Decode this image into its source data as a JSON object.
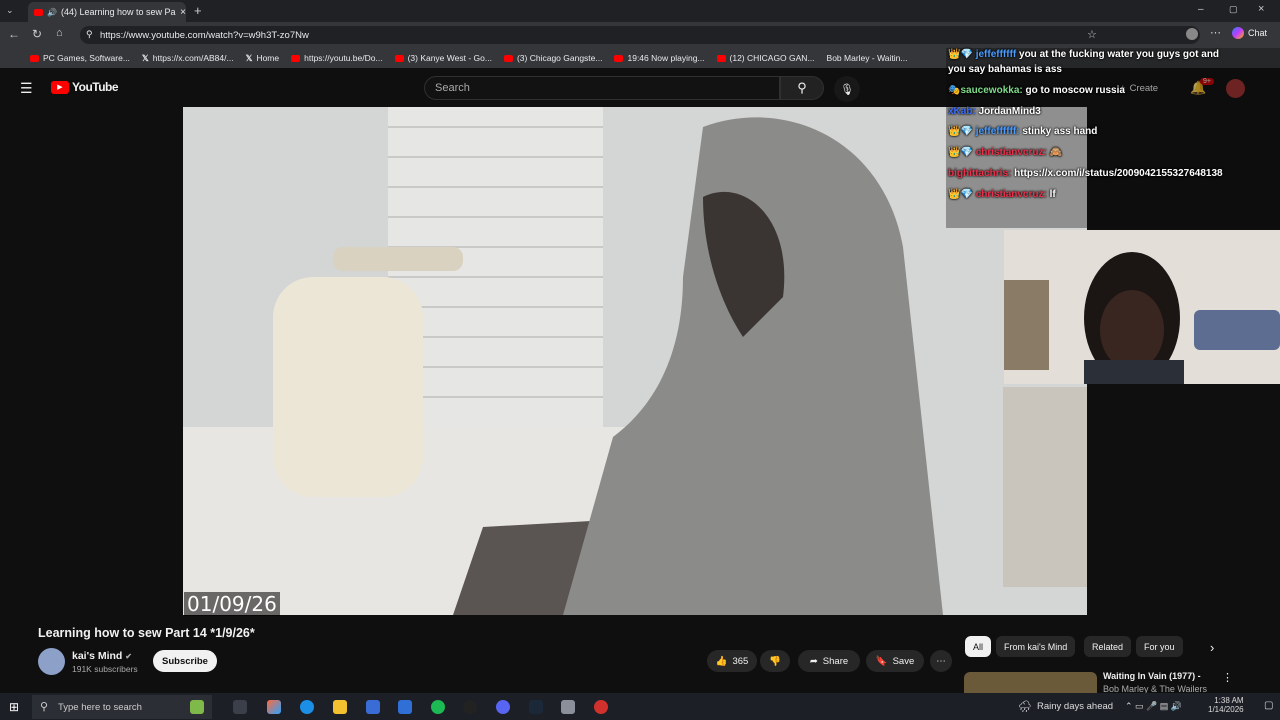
{
  "browser": {
    "tab_title": "(44) Learning how to sew Pa",
    "url": "https://www.youtube.com/watch?v=w9h3T-zo7Nw",
    "chat_label": "Chat",
    "bookmarks": [
      "PC Games, Software...",
      "https://x.com/AB84/...",
      "Home",
      "https://youtu.be/Do...",
      "(3) Kanye West - Go...",
      "(3) Chicago Gangste...",
      "19:46 Now playing...",
      "(12) CHICAGO GAN...",
      "Bob Marley - Waitin..."
    ]
  },
  "youtube": {
    "logo": "YouTube",
    "search_placeholder": "Search",
    "create_label": "Create",
    "notif_count": "9+",
    "video": {
      "date_overlay": "01/09/26",
      "title": "Learning how to sew Part 14 *1/9/26*",
      "channel": "kai's Mind",
      "subscribers": "191K subscribers",
      "subscribe_label": "Subscribe",
      "likes": "365",
      "share_label": "Share",
      "save_label": "Save"
    },
    "chips": [
      "All",
      "From kai's Mind",
      "Related",
      "For you"
    ],
    "recommendation": {
      "title": "Waiting In Vain (1977) -",
      "subtitle": "Bob Marley & The Wailers"
    }
  },
  "chat": [
    {
      "user": "jeffeffffff",
      "text": "you at the fucking water you guys got and",
      "user_color": "#4a9cff"
    },
    {
      "user": "",
      "text": "you say bahamas is ass",
      "user_color": "#ffffff"
    },
    {
      "user": "saucewokka:",
      "text": "go to moscow russia",
      "user_color": "#7fdc8a"
    },
    {
      "user": "xKab:",
      "text": "JordanMind3",
      "user_color": "#3b6cff"
    },
    {
      "user": "jeffeffffff:",
      "text": "stinky ass hand",
      "user_color": "#4a9cff"
    },
    {
      "user": "christianvcruz:",
      "text": "🙈",
      "user_color": "#e8314a"
    },
    {
      "user": "bighittachris:",
      "text": "https://x.com/i/status/2009042155327648138",
      "user_color": "#e8314a"
    },
    {
      "user": "christianvcruz:",
      "text": "lf",
      "user_color": "#e8314a"
    }
  ],
  "taskbar": {
    "search_placeholder": "Type here to search",
    "weather": "Rainy days ahead",
    "time": "1:38 AM",
    "date": "1/14/2026"
  }
}
